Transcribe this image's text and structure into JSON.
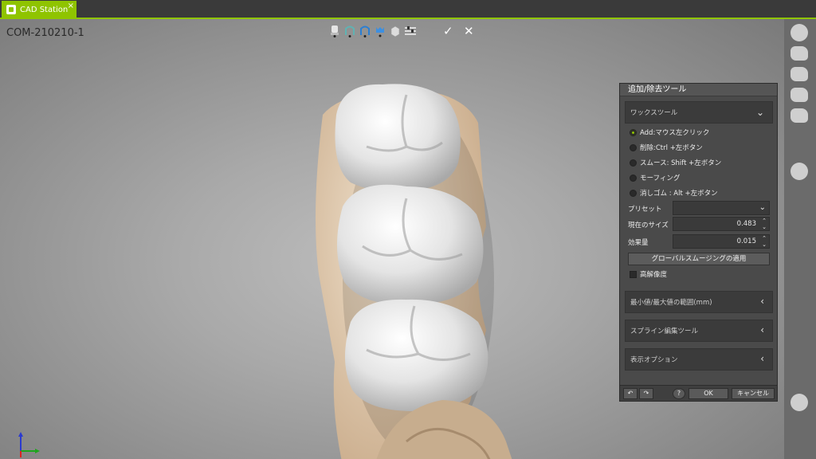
{
  "tab": {
    "label": "CAD Station",
    "close": "×"
  },
  "viewport": {
    "case_id": "COM-210210-1"
  },
  "toolbar": {
    "confirm": "✓",
    "cancel": "✕"
  },
  "panel": {
    "title": "追加/除去ツール",
    "wax_section": "ワックスツール",
    "modes": [
      {
        "label": "Add:マウス左クリック",
        "selected": true
      },
      {
        "label": "削除:Ctrl +左ボタン",
        "selected": false
      },
      {
        "label": "スムース: Shift +左ボタン",
        "selected": false
      },
      {
        "label": "モーフィング",
        "selected": false
      },
      {
        "label": "消しゴム : Alt +左ボタン",
        "selected": false
      }
    ],
    "preset_label": "プリセット",
    "preset_value": "",
    "size_label": "現在のサイズ",
    "size_value": "0.483",
    "effect_label": "効果量",
    "effect_value": "0.015",
    "global_smoothing": "グローバルスムージングの適用",
    "high_res_label": "高解像度",
    "high_res_checked": false,
    "minmax_section": "最小値/最大値の範囲(mm)",
    "spline_section": "スプライン編集ツール",
    "display_section": "表示オプション",
    "undo": "↶",
    "redo": "↷",
    "help": "?",
    "ok": "OK",
    "cancel": "キャンセル"
  },
  "colors": {
    "accent": "#8fc400",
    "panel": "#4a4a4a",
    "tooth": "#e9e9e9",
    "gum": "#e6d2b8"
  }
}
